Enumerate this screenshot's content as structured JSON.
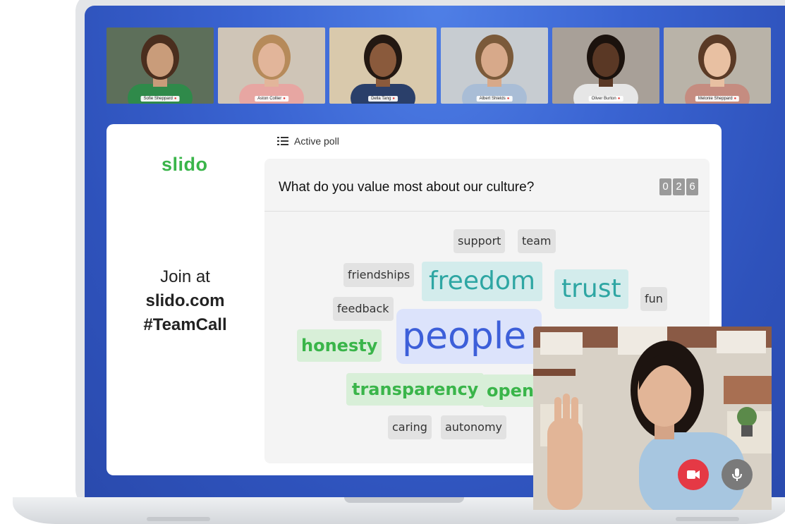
{
  "participants": [
    {
      "name": "Sofie Sheppard",
      "bg": "#5d6f5a",
      "skin": "#c99c7a",
      "hair": "#4a2e1e",
      "shirt": "#2f8a4a"
    },
    {
      "name": "Aston Collier",
      "bg": "#cfc5b7",
      "skin": "#e2b59a",
      "hair": "#b68a5a",
      "shirt": "#e7a6a2"
    },
    {
      "name": "Della Tang",
      "bg": "#d9c9ac",
      "skin": "#8a5a3c",
      "hair": "#231812",
      "shirt": "#2a3f6a"
    },
    {
      "name": "Albert Shields",
      "bg": "#c7ccd1",
      "skin": "#d7a98a",
      "hair": "#7b5a3a",
      "shirt": "#a9bdd6"
    },
    {
      "name": "Oliver Burton",
      "bg": "#a8a098",
      "skin": "#5a3825",
      "hair": "#1b120d",
      "shirt": "#e6e6e6"
    },
    {
      "name": "Melonie Sheppard",
      "bg": "#b9b3a8",
      "skin": "#e8c0a2",
      "hair": "#5a3a26",
      "shirt": "#c58c80"
    }
  ],
  "sidebar": {
    "logo": "slido",
    "join_line1": "Join at",
    "join_line2": "slido.com",
    "join_line3": "#TeamCall"
  },
  "poll": {
    "header_label": "Active poll",
    "question": "What do you value most about our culture?",
    "counter_digits": [
      "0",
      "2",
      "6"
    ]
  },
  "words": [
    {
      "text": "support",
      "style": "gray"
    },
    {
      "text": "team",
      "style": "gray"
    },
    {
      "text": "friendships",
      "style": "gray"
    },
    {
      "text": "freedom",
      "style": "teal"
    },
    {
      "text": "trust",
      "style": "teal"
    },
    {
      "text": "fun",
      "style": "gray"
    },
    {
      "text": "feedback",
      "style": "gray"
    },
    {
      "text": "people",
      "style": "blue"
    },
    {
      "text": "honesty",
      "style": "green"
    },
    {
      "text": "transparency",
      "style": "green"
    },
    {
      "text": "open",
      "style": "green"
    },
    {
      "text": "caring",
      "style": "gray"
    },
    {
      "text": "autonomy",
      "style": "gray"
    }
  ],
  "controls": {
    "camera_color": "#e53945",
    "mic_color": "#7a7a7a"
  },
  "colors": {
    "screen": "#3a64d2",
    "brand_green": "#3ab54a"
  }
}
